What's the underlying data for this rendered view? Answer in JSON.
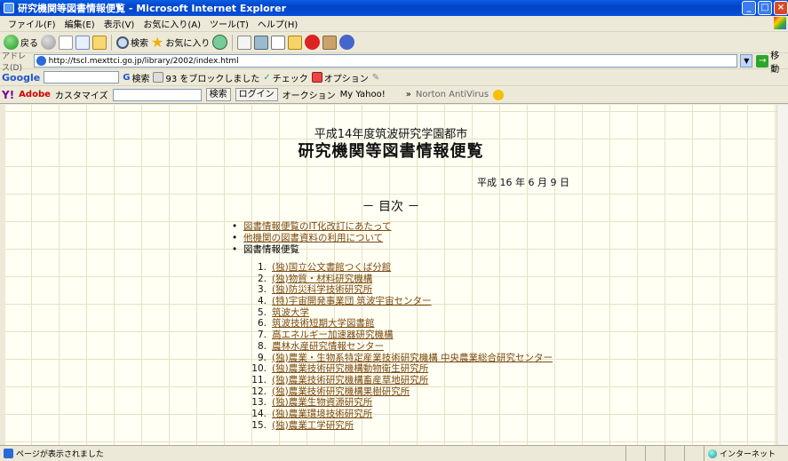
{
  "window": {
    "title": "研究機関等図書情報便覧 - Microsoft Internet Explorer",
    "buttons": [
      "_",
      "□",
      "×"
    ]
  },
  "menu": [
    "ファイル(F)",
    "編集(E)",
    "表示(V)",
    "お気に入り(A)",
    "ツール(T)",
    "ヘルプ(H)"
  ],
  "toolbar": {
    "back": "戻る",
    "search": "検索",
    "favorites": "お気に入り"
  },
  "address": {
    "label": "アドレス(D)",
    "url": "http://tscl.mexttci.go.jp/library/2002/index.html",
    "go": "移動"
  },
  "google_bar": {
    "logo": "Google",
    "search_label": "検索",
    "blocked": "93 をブロックしました",
    "check": "チェック",
    "options": "オプション"
  },
  "yahoo_bar": {
    "logo": "Adobe",
    "customize": "カスタマイズ",
    "search_button": "検索",
    "login": "ログイン",
    "auction": "オークション",
    "my_yahoo": "My Yahoo!",
    "norton": "Norton AntiVirus"
  },
  "page": {
    "subtitle": "平成14年度筑波研究学園都市",
    "title": "研究機関等図書情報便覧",
    "date": "平成 16 年 6 月 9 日",
    "toc": "－ 目次 －",
    "top_items": [
      {
        "label": "図書情報便覧のIT化改訂にあたって",
        "link": true
      },
      {
        "label": "他機関の図書資料の利用について",
        "link": true
      },
      {
        "label": "図書情報便覧",
        "link": false
      }
    ],
    "institutions": [
      {
        "num": "1.",
        "label": "(独)国立公文書館つくば分館"
      },
      {
        "num": "2.",
        "label": "(独)物質・材料研究機構"
      },
      {
        "num": "3.",
        "label": "(独)防災科学技術研究所"
      },
      {
        "num": "4.",
        "label": "(特)宇宙開発事業団 筑波宇宙センター"
      },
      {
        "num": "5.",
        "label": "筑波大学"
      },
      {
        "num": "6.",
        "label": "筑波技術短期大学図書館"
      },
      {
        "num": "7.",
        "label": "高エネルギー加速器研究機構"
      },
      {
        "num": "8.",
        "label": "農林水産研究情報センター"
      },
      {
        "num": "9.",
        "label": "(独)農業・生物系特定産業技術研究機構 中央農業総合研究センター"
      },
      {
        "num": "10.",
        "label": "(独)農業技術研究機構動物衛生研究所"
      },
      {
        "num": "11.",
        "label": "(独)農業技術研究機構畜産草地研究所"
      },
      {
        "num": "12.",
        "label": "(独)農業技術研究機構果樹研究所"
      },
      {
        "num": "13.",
        "label": "(独)農業生物資源研究所"
      },
      {
        "num": "14.",
        "label": "(独)農業環境技術研究所"
      },
      {
        "num": "15.",
        "label": "(独)農業工学研究所"
      }
    ]
  },
  "status": {
    "text": "ページが表示されました",
    "zone": "インターネット"
  }
}
